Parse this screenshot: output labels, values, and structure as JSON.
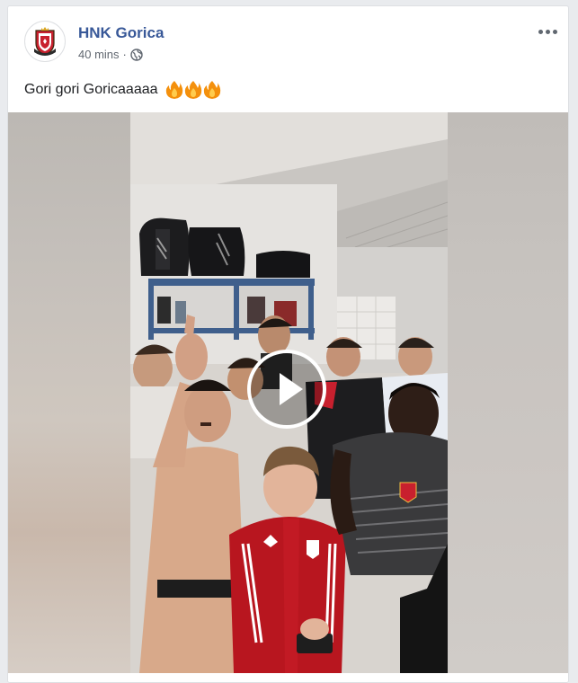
{
  "post": {
    "page_name": "HNK Gorica",
    "timestamp": "40 mins",
    "separator": "·",
    "privacy_icon": "globe-icon",
    "text": "Gori gori Goricaaaaa",
    "emoji_icons": [
      "fire-icon",
      "fire-icon",
      "fire-icon"
    ],
    "more_icon": "more-horizontal-icon"
  },
  "video": {
    "play_icon": "play-icon"
  },
  "colors": {
    "page_name": "#385898",
    "meta_text": "#616770",
    "body_text": "#1c1e21",
    "club_red": "#c8202e"
  }
}
